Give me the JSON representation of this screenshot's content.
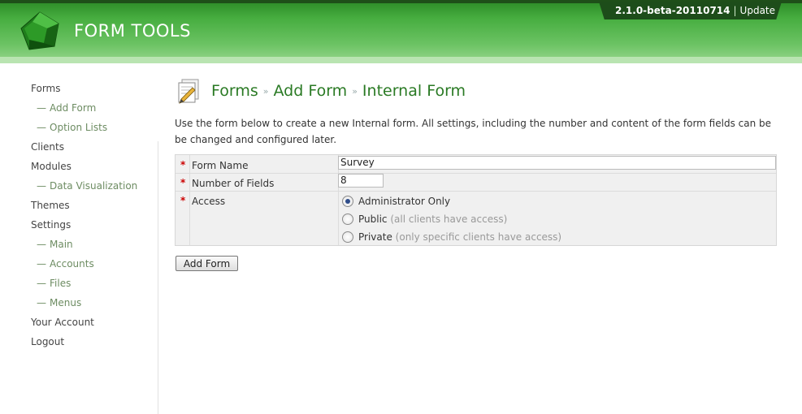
{
  "header": {
    "logo_text": "FORM TOOLS",
    "version": "2.1.0-beta-20110714",
    "separator": "|",
    "update_link": "Update"
  },
  "sidebar": {
    "items": [
      {
        "label": "Forms",
        "type": "main"
      },
      {
        "label": "Add Form",
        "type": "sub"
      },
      {
        "label": "Option Lists",
        "type": "sub"
      },
      {
        "label": "Clients",
        "type": "main"
      },
      {
        "label": "Modules",
        "type": "main"
      },
      {
        "label": "Data Visualization",
        "type": "sub"
      },
      {
        "label": "Themes",
        "type": "main"
      },
      {
        "label": "Settings",
        "type": "main"
      },
      {
        "label": "Main",
        "type": "sub"
      },
      {
        "label": "Accounts",
        "type": "sub"
      },
      {
        "label": "Files",
        "type": "sub"
      },
      {
        "label": "Menus",
        "type": "sub"
      },
      {
        "label": "Your Account",
        "type": "main"
      },
      {
        "label": "Logout",
        "type": "main"
      }
    ],
    "sub_prefix": "—"
  },
  "main": {
    "breadcrumb": [
      "Forms",
      "Add Form",
      "Internal Form"
    ],
    "breadcrumb_separator": "»",
    "intro_text": "Use the form below to create a new Internal form. All settings, including the number and content of the form fields can be be changed and configured later.",
    "fields": {
      "required_marker": "*",
      "form_name_label": "Form Name",
      "form_name_value": "Survey",
      "num_fields_label": "Number of Fields",
      "num_fields_value": "8",
      "access_label": "Access",
      "access_options": [
        {
          "label": "Administrator Only",
          "hint": "",
          "checked": true
        },
        {
          "label": "Public",
          "hint": "(all clients have access)",
          "checked": false
        },
        {
          "label": "Private",
          "hint": "(only specific clients have access)",
          "checked": false
        }
      ]
    },
    "submit_label": "Add Form"
  },
  "colors": {
    "brand_green": "#2a7a24",
    "header_dark": "#1d4d1a",
    "required_red": "#cc0000"
  }
}
